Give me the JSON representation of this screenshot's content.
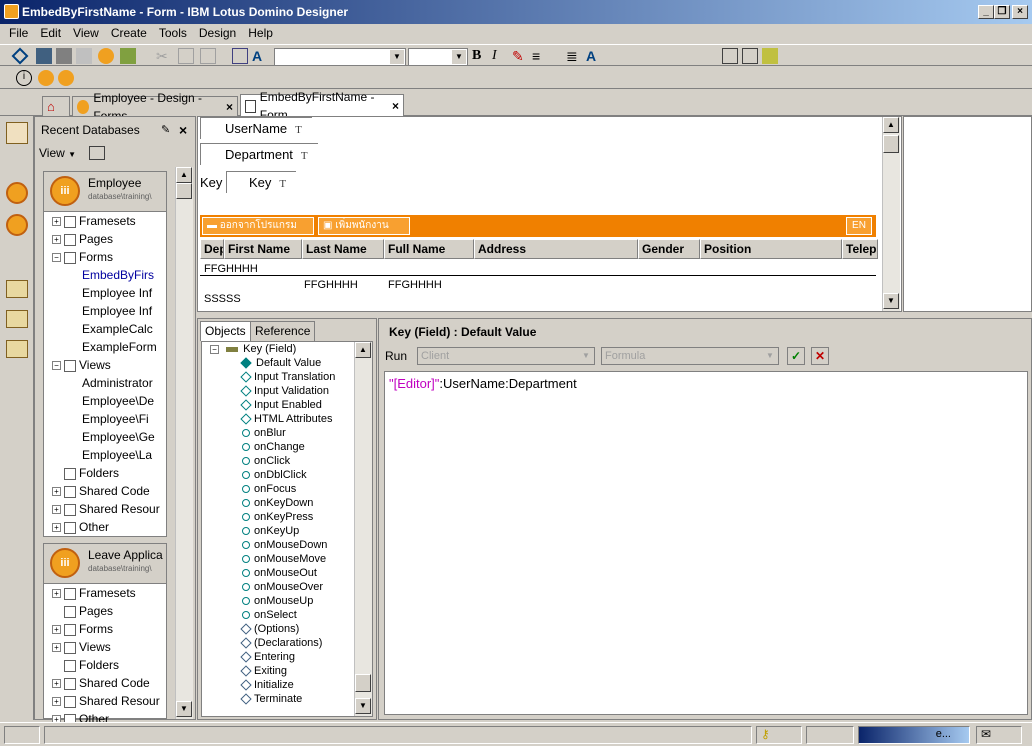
{
  "window": {
    "title": "EmbedByFirstName - Form - IBM Lotus Domino Designer"
  },
  "menu": [
    "File",
    "Edit",
    "View",
    "Create",
    "Tools",
    "Design",
    "Help"
  ],
  "tabs": [
    {
      "label": "Employee - Design - Forms"
    },
    {
      "label": "EmbedByFirstName - Form"
    }
  ],
  "sidebar": {
    "title": "Recent Databases",
    "view_label": "View",
    "databases": [
      {
        "name": "Employee",
        "path": "database\\training\\",
        "items": [
          {
            "label": "Framesets",
            "level": 0,
            "expander": "+"
          },
          {
            "label": "Pages",
            "level": 0,
            "expander": "+"
          },
          {
            "label": "Forms",
            "level": 0,
            "expander": "-"
          },
          {
            "label": "EmbedByFirs",
            "level": 1,
            "expander": "",
            "selected": true
          },
          {
            "label": "Employee Inf",
            "level": 1,
            "expander": ""
          },
          {
            "label": "Employee Inf",
            "level": 1,
            "expander": ""
          },
          {
            "label": "ExampleCalc",
            "level": 1,
            "expander": ""
          },
          {
            "label": "ExampleForm",
            "level": 1,
            "expander": ""
          },
          {
            "label": "Views",
            "level": 0,
            "expander": "-"
          },
          {
            "label": "Administrator",
            "level": 1,
            "expander": ""
          },
          {
            "label": "Employee\\De",
            "level": 1,
            "expander": ""
          },
          {
            "label": "Employee\\Fi",
            "level": 1,
            "expander": ""
          },
          {
            "label": "Employee\\Ge",
            "level": 1,
            "expander": ""
          },
          {
            "label": "Employee\\La",
            "level": 1,
            "expander": ""
          },
          {
            "label": "Folders",
            "level": 0,
            "expander": ""
          },
          {
            "label": "Shared Code",
            "level": 0,
            "expander": "+"
          },
          {
            "label": "Shared Resour",
            "level": 0,
            "expander": "+"
          },
          {
            "label": "Other",
            "level": 0,
            "expander": "+"
          }
        ]
      },
      {
        "name": "Leave Applica",
        "path": "database\\training\\",
        "items": [
          {
            "label": "Framesets",
            "level": 0,
            "expander": "+"
          },
          {
            "label": "Pages",
            "level": 0,
            "expander": ""
          },
          {
            "label": "Forms",
            "level": 0,
            "expander": "+"
          },
          {
            "label": "Views",
            "level": 0,
            "expander": "+"
          },
          {
            "label": "Folders",
            "level": 0,
            "expander": ""
          },
          {
            "label": "Shared Code",
            "level": 0,
            "expander": "+"
          },
          {
            "label": "Shared Resour",
            "level": 0,
            "expander": "+"
          },
          {
            "label": "Other",
            "level": 0,
            "expander": "+"
          }
        ]
      }
    ]
  },
  "form": {
    "fields": [
      {
        "label": "UserName",
        "type": "T"
      },
      {
        "label": "Department",
        "type": "T"
      },
      {
        "label": "Key",
        "type": "T",
        "prefix": "Key"
      }
    ],
    "action_buttons": [
      "ออกจากโปรแกรม",
      "เพิ่มพนักงาน"
    ],
    "lang_button": "EN",
    "columns": [
      "Dep",
      "First Name",
      "Last Name",
      "Full Name",
      "Address",
      "Gender",
      "Position",
      "Telep"
    ],
    "rows": [
      {
        "col0": "FFGHHHH",
        "col1": "",
        "col2": ""
      },
      {
        "col0": "",
        "col1": "FFGHHHH",
        "col2": "FFGHHHH"
      },
      {
        "col0": "SSSSS",
        "col1": "",
        "col2": ""
      }
    ]
  },
  "objects": {
    "tabs": [
      "Objects",
      "Reference"
    ],
    "root": "Key (Field)",
    "items": [
      {
        "label": "Default Value",
        "kind": "diamond-filled",
        "selected": true
      },
      {
        "label": "Input Translation",
        "kind": "diamond"
      },
      {
        "label": "Input Validation",
        "kind": "diamond"
      },
      {
        "label": "Input Enabled",
        "kind": "diamond"
      },
      {
        "label": "HTML Attributes",
        "kind": "diamond"
      },
      {
        "label": "onBlur",
        "kind": "circle"
      },
      {
        "label": "onChange",
        "kind": "circle"
      },
      {
        "label": "onClick",
        "kind": "circle"
      },
      {
        "label": "onDblClick",
        "kind": "circle"
      },
      {
        "label": "onFocus",
        "kind": "circle"
      },
      {
        "label": "onKeyDown",
        "kind": "circle"
      },
      {
        "label": "onKeyPress",
        "kind": "circle"
      },
      {
        "label": "onKeyUp",
        "kind": "circle"
      },
      {
        "label": "onMouseDown",
        "kind": "circle"
      },
      {
        "label": "onMouseMove",
        "kind": "circle"
      },
      {
        "label": "onMouseOut",
        "kind": "circle"
      },
      {
        "label": "onMouseOver",
        "kind": "circle"
      },
      {
        "label": "onMouseUp",
        "kind": "circle"
      },
      {
        "label": "onSelect",
        "kind": "circle"
      },
      {
        "label": "(Options)",
        "kind": "script"
      },
      {
        "label": "(Declarations)",
        "kind": "script"
      },
      {
        "label": "Entering",
        "kind": "script"
      },
      {
        "label": "Exiting",
        "kind": "script"
      },
      {
        "label": "Initialize",
        "kind": "script"
      },
      {
        "label": "Terminate",
        "kind": "script"
      }
    ]
  },
  "code": {
    "title": "Key (Field) : Default Value",
    "run_label": "Run",
    "run_target": "Client",
    "language": "Formula",
    "formula_string": "\"[Editor]\"",
    "formula_rest": ":UserName:Department"
  },
  "status": {
    "field_text": "e..."
  },
  "colors": {
    "accent": "#f08000",
    "titlebar": "#0a246a",
    "formula_string": "#c000c0"
  }
}
